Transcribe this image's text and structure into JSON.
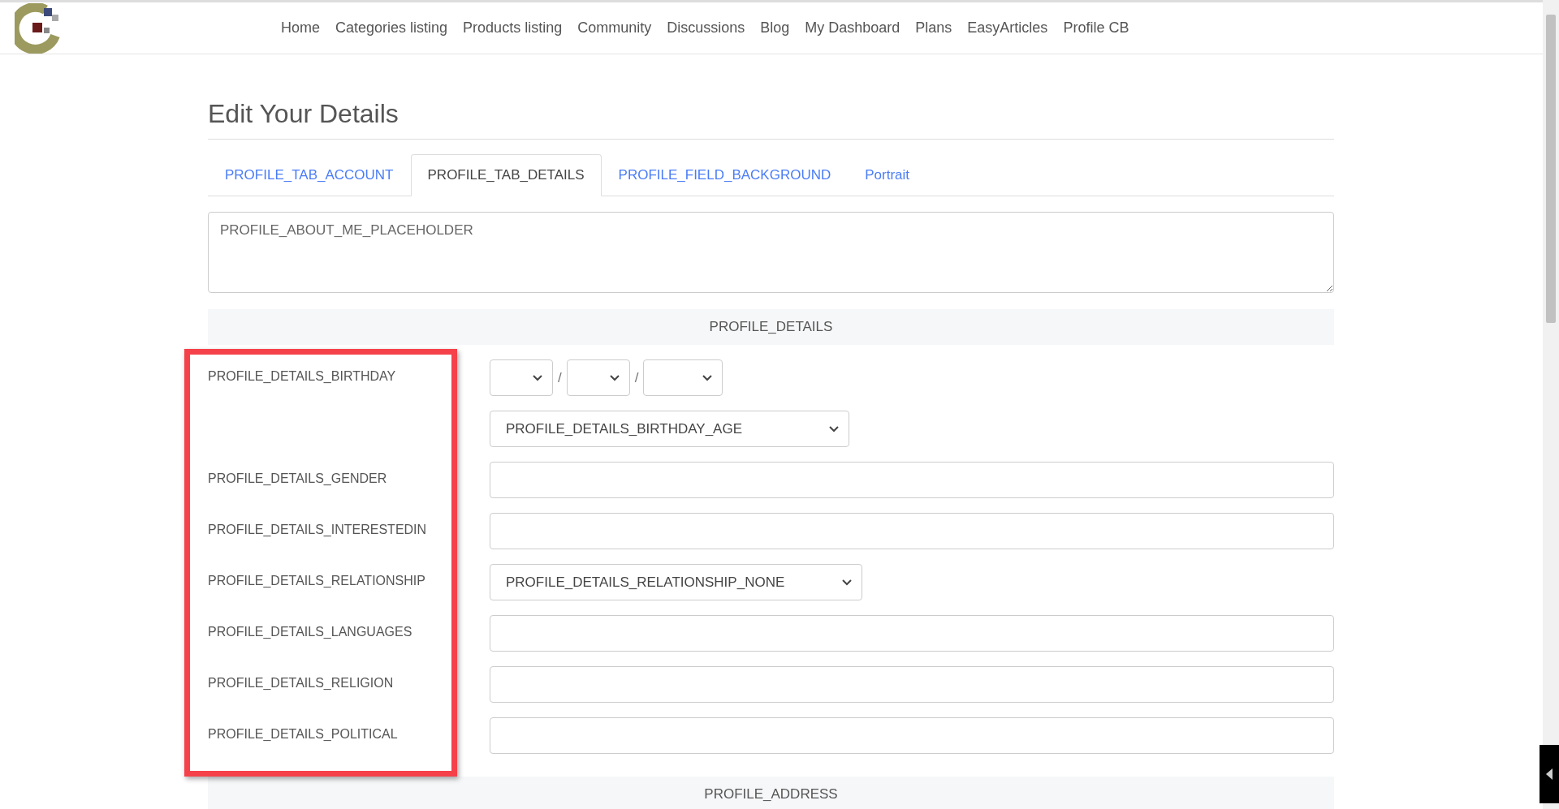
{
  "nav": {
    "items": [
      "Home",
      "Categories listing",
      "Products listing",
      "Community",
      "Discussions",
      "Blog",
      "My Dashboard",
      "Plans",
      "EasyArticles",
      "Profile CB"
    ]
  },
  "page": {
    "title": "Edit Your Details"
  },
  "tabs": [
    {
      "label": "PROFILE_TAB_ACCOUNT",
      "selected": false
    },
    {
      "label": "PROFILE_TAB_DETAILS",
      "selected": true
    },
    {
      "label": "PROFILE_FIELD_BACKGROUND",
      "selected": false
    },
    {
      "label": "Portrait",
      "selected": false
    }
  ],
  "about_me": {
    "placeholder": "PROFILE_ABOUT_ME_PLACEHOLDER"
  },
  "sections": [
    {
      "title": "PROFILE_DETAILS",
      "fields": [
        {
          "label": "PROFILE_DETAILS_BIRTHDAY",
          "kind": "date",
          "separators": [
            "/",
            "/"
          ],
          "age_select": "PROFILE_DETAILS_BIRTHDAY_AGE"
        },
        {
          "label": "PROFILE_DETAILS_GENDER",
          "kind": "text"
        },
        {
          "label": "PROFILE_DETAILS_INTERESTEDIN",
          "kind": "text"
        },
        {
          "label": "PROFILE_DETAILS_RELATIONSHIP",
          "kind": "select",
          "value": "PROFILE_DETAILS_RELATIONSHIP_NONE"
        },
        {
          "label": "PROFILE_DETAILS_LANGUAGES",
          "kind": "text"
        },
        {
          "label": "PROFILE_DETAILS_RELIGION",
          "kind": "text"
        },
        {
          "label": "PROFILE_DETAILS_POLITICAL",
          "kind": "text"
        }
      ]
    },
    {
      "title": "PROFILE_ADDRESS"
    }
  ]
}
